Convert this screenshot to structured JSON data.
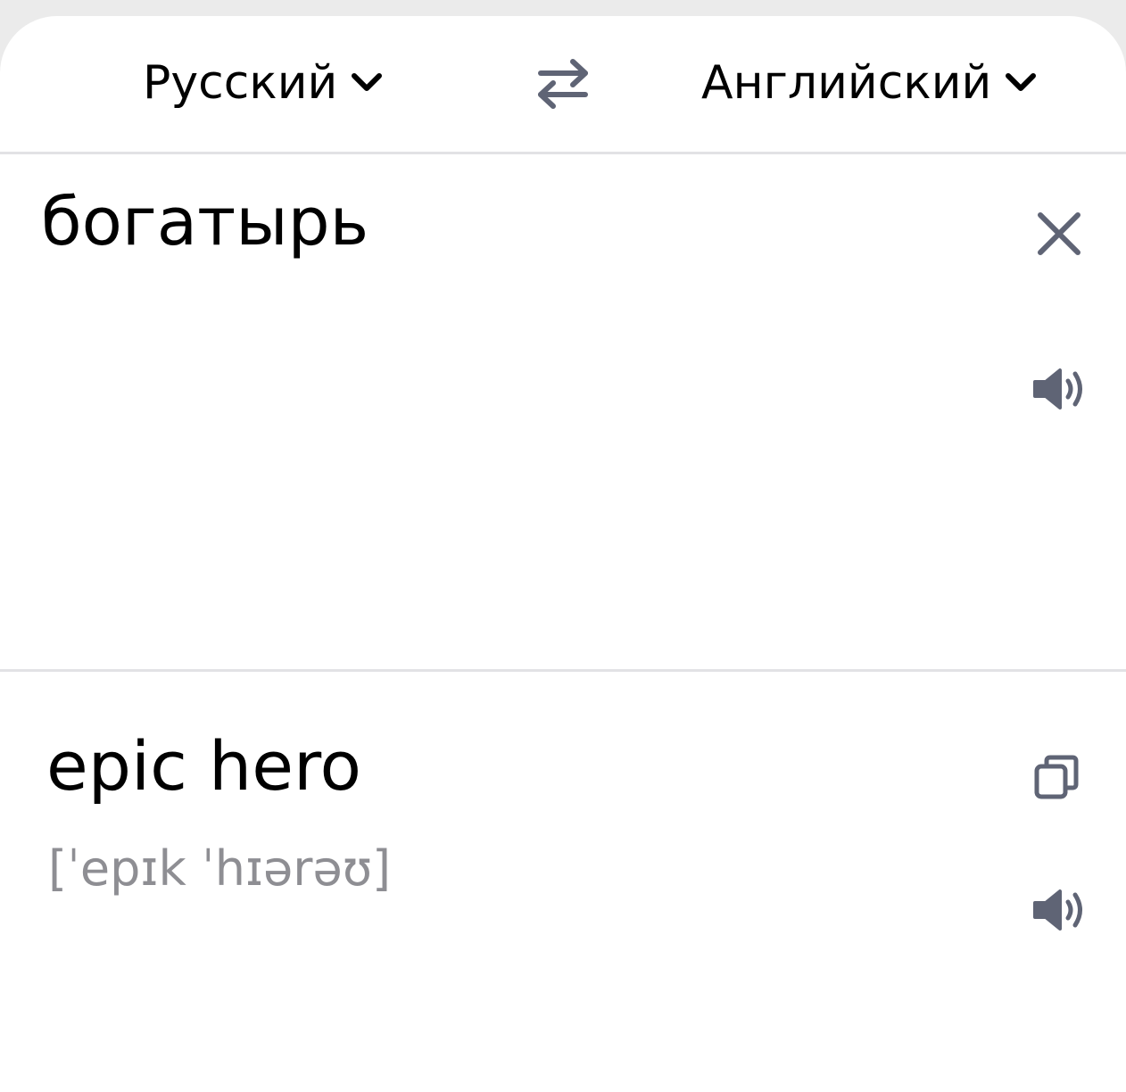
{
  "languages": {
    "source": "Русский",
    "target": "Английский"
  },
  "input": {
    "text": "богатырь"
  },
  "output": {
    "translation": "epic hero",
    "transcription": "[ˈepɪk ˈhɪərəʊ]"
  },
  "icons": {
    "source_dropdown": "chevron-down-icon",
    "target_dropdown": "chevron-down-icon",
    "swap": "swap-arrows-icon",
    "clear": "close-icon",
    "speak_source": "speaker-icon",
    "copy": "copy-icon",
    "speak_target": "speaker-icon"
  },
  "colors": {
    "icon": "#5f6475",
    "divider": "#e2e2e5",
    "transcription": "#8e8e93",
    "background": "#ebebeb"
  }
}
